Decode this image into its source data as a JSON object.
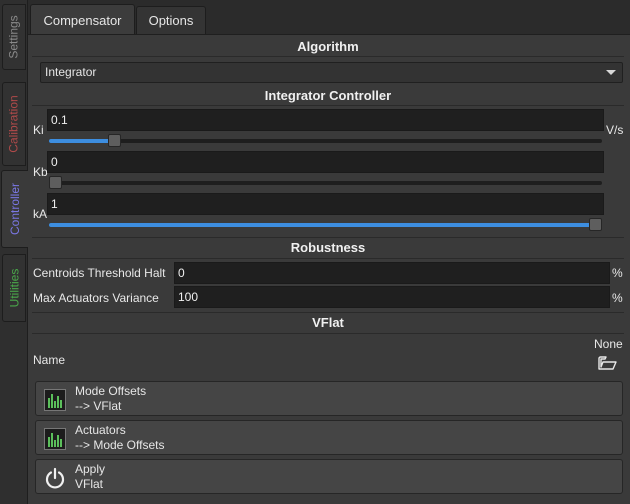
{
  "side_tabs": {
    "settings": {
      "label": "Settings",
      "color": "#8a8a8a"
    },
    "calibration": {
      "label": "Calibration",
      "color": "#b04a4a"
    },
    "controller": {
      "label": "Controller",
      "color": "#7b78e6"
    },
    "utilities": {
      "label": "Utilities",
      "color": "#4aa84a"
    }
  },
  "top_tabs": {
    "compensator": "Compensator",
    "options": "Options"
  },
  "algorithm": {
    "title": "Algorithm",
    "selected": "Integrator"
  },
  "integrator": {
    "title": "Integrator Controller",
    "ki": {
      "label": "Ki",
      "value": "0.1",
      "unit": "V/s",
      "level": 0.11
    },
    "kb": {
      "label": "Kb",
      "value": "0",
      "level": 0.0
    },
    "ka": {
      "label": "kA",
      "value": "1",
      "level": 1.0
    }
  },
  "robustness": {
    "title": "Robustness",
    "centroids": {
      "label": "Centroids Threshold Halt",
      "value": "0",
      "unit": "%"
    },
    "actuators": {
      "label": "Max Actuators Variance",
      "value": "100",
      "unit": "%"
    }
  },
  "vflat": {
    "title": "VFlat",
    "name_label": "Name",
    "name_value": "None",
    "buttons": [
      {
        "line1": "Mode Offsets",
        "line2": "--> VFlat",
        "icon": "chart-icon"
      },
      {
        "line1": "Actuators",
        "line2": "--> Mode Offsets",
        "icon": "chart-icon"
      },
      {
        "line1": "Apply",
        "line2": "VFlat",
        "icon": "power-icon"
      }
    ]
  },
  "accent_color": "#3d8ee0"
}
